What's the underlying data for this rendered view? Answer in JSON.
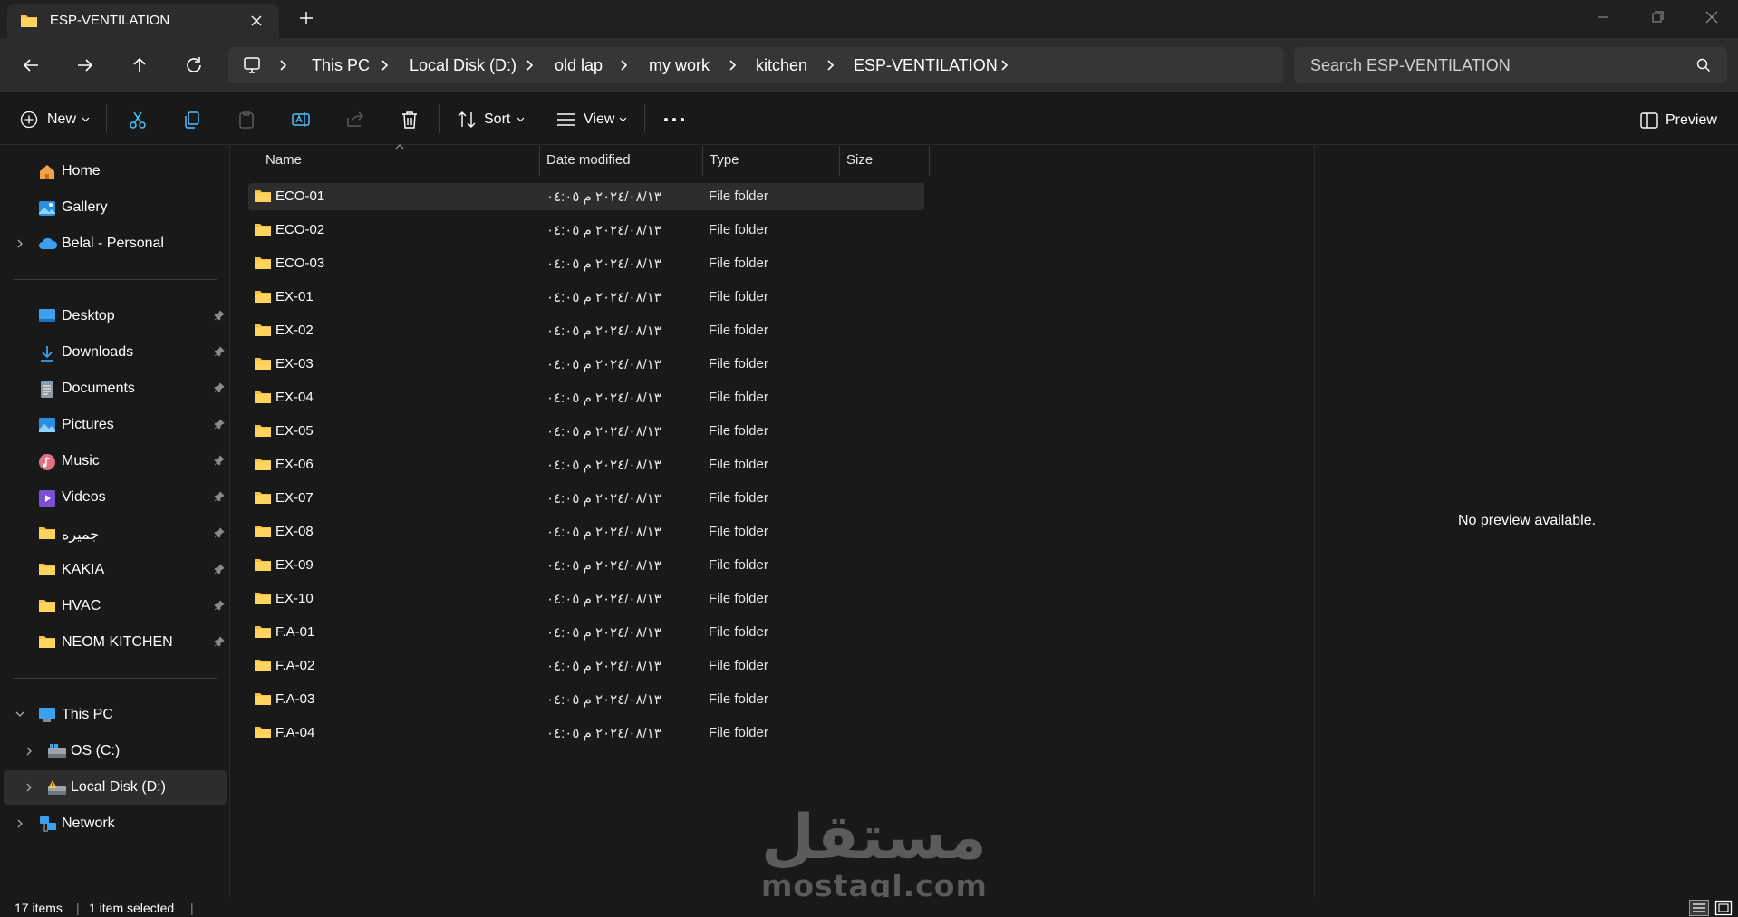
{
  "tab": {
    "title": "ESP-VENTILATION"
  },
  "address": {
    "crumbs": [
      "This PC",
      "Local Disk (D:)",
      "old lap",
      "my work",
      "kitchen",
      "ESP-VENTILATION"
    ]
  },
  "search": {
    "placeholder": "Search ESP-VENTILATION"
  },
  "toolbar": {
    "new_label": "New",
    "sort_label": "Sort",
    "view_label": "View",
    "preview_label": "Preview"
  },
  "sidebar": {
    "top_items": [
      {
        "label": "Home",
        "icon": "home-icon"
      },
      {
        "label": "Gallery",
        "icon": "gallery-icon"
      },
      {
        "label": "Belal - Personal",
        "icon": "cloud-icon"
      }
    ],
    "pinned": [
      {
        "label": "Desktop",
        "icon": "desktop-icon"
      },
      {
        "label": "Downloads",
        "icon": "download-icon"
      },
      {
        "label": "Documents",
        "icon": "documents-icon"
      },
      {
        "label": "Pictures",
        "icon": "pictures-icon"
      },
      {
        "label": "Music",
        "icon": "music-icon"
      },
      {
        "label": "Videos",
        "icon": "videos-icon"
      },
      {
        "label": "جميره",
        "icon": "folder-icon"
      },
      {
        "label": "KAKIA",
        "icon": "folder-icon"
      },
      {
        "label": "HVAC",
        "icon": "folder-icon"
      },
      {
        "label": "NEOM KITCHEN",
        "icon": "folder-icon"
      }
    ],
    "this_pc": "This PC",
    "drives": [
      "OS (C:)",
      "Local Disk (D:)"
    ],
    "network": "Network"
  },
  "columns": {
    "name": "Name",
    "date": "Date modified",
    "type": "Type",
    "size": "Size"
  },
  "files": [
    {
      "name": "ECO-01",
      "date": "٢٠٢٤/٠٨/١٣ م ٠٤:٠٥",
      "type": "File folder"
    },
    {
      "name": "ECO-02",
      "date": "٢٠٢٤/٠٨/١٣ م ٠٤:٠٥",
      "type": "File folder"
    },
    {
      "name": "ECO-03",
      "date": "٢٠٢٤/٠٨/١٣ م ٠٤:٠٥",
      "type": "File folder"
    },
    {
      "name": "EX-01",
      "date": "٢٠٢٤/٠٨/١٣ م ٠٤:٠٥",
      "type": "File folder"
    },
    {
      "name": "EX-02",
      "date": "٢٠٢٤/٠٨/١٣ م ٠٤:٠٥",
      "type": "File folder"
    },
    {
      "name": "EX-03",
      "date": "٢٠٢٤/٠٨/١٣ م ٠٤:٠٥",
      "type": "File folder"
    },
    {
      "name": "EX-04",
      "date": "٢٠٢٤/٠٨/١٣ م ٠٤:٠٥",
      "type": "File folder"
    },
    {
      "name": "EX-05",
      "date": "٢٠٢٤/٠٨/١٣ م ٠٤:٠٥",
      "type": "File folder"
    },
    {
      "name": "EX-06",
      "date": "٢٠٢٤/٠٨/١٣ م ٠٤:٠٥",
      "type": "File folder"
    },
    {
      "name": "EX-07",
      "date": "٢٠٢٤/٠٨/١٣ م ٠٤:٠٥",
      "type": "File folder"
    },
    {
      "name": "EX-08",
      "date": "٢٠٢٤/٠٨/١٣ م ٠٤:٠٥",
      "type": "File folder"
    },
    {
      "name": "EX-09",
      "date": "٢٠٢٤/٠٨/١٣ م ٠٤:٠٥",
      "type": "File folder"
    },
    {
      "name": "EX-10",
      "date": "٢٠٢٤/٠٨/١٣ م ٠٤:٠٥",
      "type": "File folder"
    },
    {
      "name": "F.A-01",
      "date": "٢٠٢٤/٠٨/١٣ م ٠٤:٠٥",
      "type": "File folder"
    },
    {
      "name": "F.A-02",
      "date": "٢٠٢٤/٠٨/١٣ م ٠٤:٠٥",
      "type": "File folder"
    },
    {
      "name": "F.A-03",
      "date": "٢٠٢٤/٠٨/١٣ م ٠٤:٠٥",
      "type": "File folder"
    },
    {
      "name": "F.A-04",
      "date": "٢٠٢٤/٠٨/١٣ م ٠٤:٠٥",
      "type": "File folder"
    }
  ],
  "preview": {
    "message": "No preview available."
  },
  "status": {
    "items": "17 items",
    "selected": "1 item selected"
  },
  "watermark": {
    "arabic": "مستقل",
    "latin": "mostaql.com"
  },
  "colors": {
    "folder": "#f5c242",
    "accent": "#4cc2ff",
    "background": "#191919"
  }
}
